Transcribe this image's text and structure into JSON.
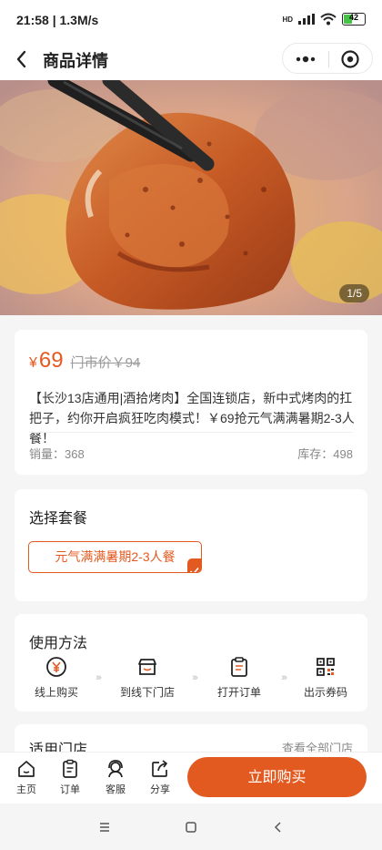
{
  "status_bar": {
    "time_speed": "21:58 | 1.3M/s",
    "network": "HD",
    "battery": "42",
    "battery_level": 0.42
  },
  "header": {
    "title": "商品详情"
  },
  "hero": {
    "page_indicator": "1/5"
  },
  "product": {
    "currency": "¥",
    "price": "69",
    "original_price": "门市价￥94",
    "description": "【长沙13店通用|酒拾烤肉】全国连锁店，新中式烤肉的扛把子，约你开启疯狂吃肉模式！￥69抢元气满满暑期2-3人餐！",
    "sales": "销量：368",
    "stock": "库存：498"
  },
  "package": {
    "title": "选择套餐",
    "option": "元气满满暑期2-3人餐"
  },
  "usage": {
    "title": "使用方法",
    "steps": [
      {
        "label": "线上购买",
        "icon": "yen-coin-icon"
      },
      {
        "label": "到线下门店",
        "icon": "store-icon"
      },
      {
        "label": "打开订单",
        "icon": "clipboard-icon"
      },
      {
        "label": "出示券码",
        "icon": "qr-code-icon"
      }
    ]
  },
  "stores": {
    "title": "适用门店",
    "link": "查看全部门店"
  },
  "bottom_nav": {
    "items": [
      {
        "label": "主页",
        "icon": "home-icon"
      },
      {
        "label": "订单",
        "icon": "order-icon"
      },
      {
        "label": "客服",
        "icon": "customer-service-icon"
      },
      {
        "label": "分享",
        "icon": "share-icon"
      }
    ],
    "buy_label": "立即购买"
  },
  "colors": {
    "accent": "#e35a20"
  }
}
